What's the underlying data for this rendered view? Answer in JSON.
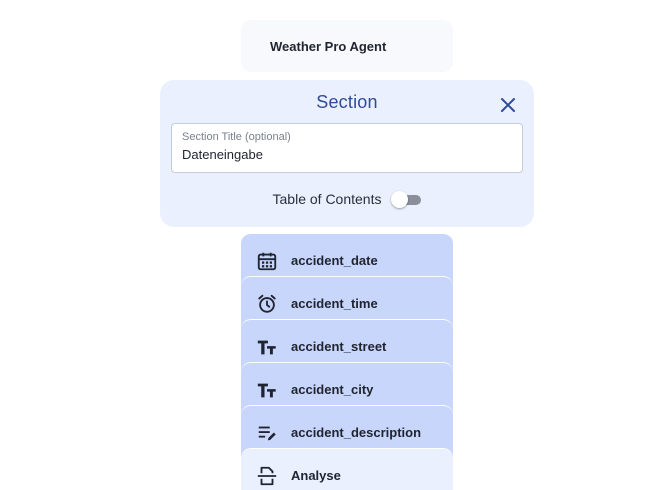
{
  "agent": {
    "name": "Weather Pro Agent"
  },
  "section": {
    "heading": "Section",
    "close_icon": "close-icon",
    "title_field": {
      "label": "Section Title (optional)",
      "value": "Dateneingabe"
    },
    "toc": {
      "label": "Table of Contents",
      "enabled": false
    }
  },
  "fields": [
    {
      "label": "accident_date",
      "icon": "calendar-icon",
      "bg": "#c9d6fb"
    },
    {
      "label": "accident_time",
      "icon": "alarm-clock-icon",
      "bg": "#c9d6fb"
    },
    {
      "label": "accident_street",
      "icon": "text-type-icon",
      "bg": "#c9d6fb"
    },
    {
      "label": "accident_city",
      "icon": "text-type-icon",
      "bg": "#c9d6fb"
    },
    {
      "label": "accident_description",
      "icon": "edit-notes-icon",
      "bg": "#c9d6fb"
    },
    {
      "label": "Analyse",
      "icon": "document-scanner-icon",
      "bg": "#ebf0ff"
    }
  ],
  "colors": {
    "accent": "#2f4a9a",
    "panel": "#ebf0ff",
    "field_item": "#c9d6fb"
  }
}
